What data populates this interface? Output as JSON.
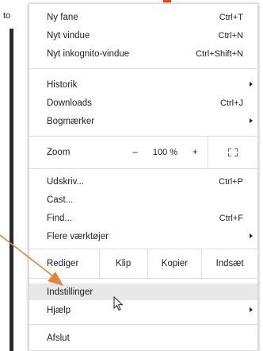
{
  "background": {
    "tab_text": "to"
  },
  "menu": {
    "group1": [
      {
        "label": "Ny fane",
        "shortcut": "Ctrl+T"
      },
      {
        "label": "Nyt vindue",
        "shortcut": "Ctrl+N"
      },
      {
        "label": "Nyt inkognito-vindue",
        "shortcut": "Ctrl+Shift+N"
      }
    ],
    "group2": [
      {
        "label": "Historik",
        "has_submenu": true
      },
      {
        "label": "Downloads",
        "shortcut": "Ctrl+J"
      },
      {
        "label": "Bogmærker",
        "has_submenu": true
      }
    ],
    "zoom": {
      "label": "Zoom",
      "minus": "–",
      "value": "100 %",
      "plus": "+"
    },
    "group3": [
      {
        "label": "Udskriv...",
        "shortcut": "Ctrl+P"
      },
      {
        "label": "Cast..."
      },
      {
        "label": "Find...",
        "shortcut": "Ctrl+F"
      },
      {
        "label": "Flere værktøjer",
        "has_submenu": true
      }
    ],
    "edit": {
      "label": "Rediger",
      "cut": "Klip",
      "copy": "Kopier",
      "paste": "Indsæt"
    },
    "group4": [
      {
        "label": "Indstillinger",
        "highlighted": true
      },
      {
        "label": "Hjælp",
        "has_submenu": true
      }
    ],
    "group5": [
      {
        "label": "Afslut"
      }
    ]
  },
  "colors": {
    "annotation_arrow": "#e8833a",
    "hover_bg": "#e8e8e8"
  }
}
